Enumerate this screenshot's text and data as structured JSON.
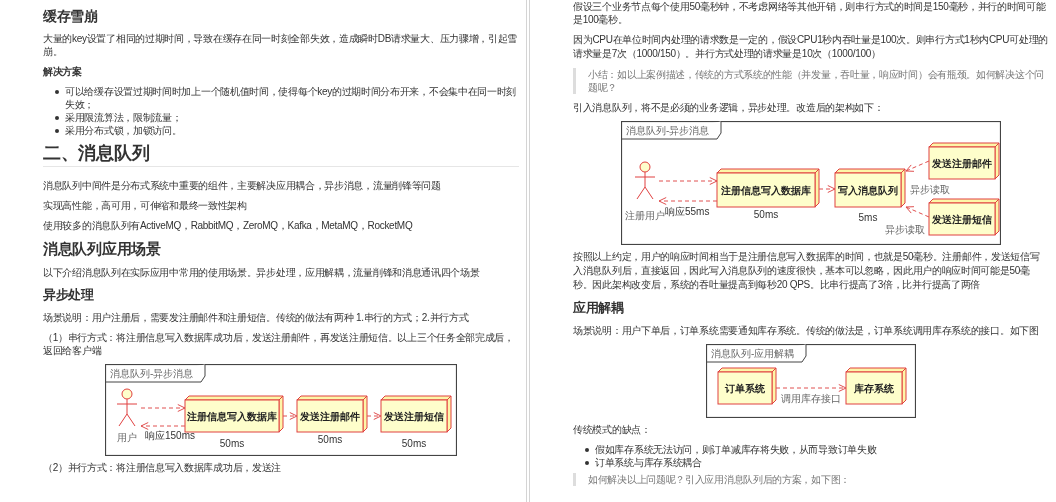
{
  "pages": [
    {
      "blocks": [
        {
          "kind": "h2",
          "text": "缓存雪崩"
        },
        {
          "kind": "p",
          "text": "大量的key设置了相同的过期时间，导致在缓存在同一时刻全部失效，造成瞬时DB请求量大、压力骤增，引起雪崩。"
        },
        {
          "kind": "h5",
          "text": "解决方案"
        },
        {
          "kind": "list",
          "items": [
            "可以给缓存设置过期时间时加上一个随机值时间，使得每个key的过期时间分布开来，不会集中在同一时刻失效；",
            "采用限流算法，限制流量；",
            "采用分布式锁，加锁访问。"
          ]
        },
        {
          "kind": "h1",
          "text": "二、消息队列"
        },
        {
          "kind": "p",
          "text": "消息队列中间件是分布式系统中重要的组件，主要解决应用耦合，异步消息，流量削锋等问题"
        },
        {
          "kind": "p",
          "text": "实现高性能，高可用，可伸缩和最终一致性架构"
        },
        {
          "kind": "p",
          "text": "使用较多的消息队列有ActiveMQ，RabbitMQ，ZeroMQ，Kafka，MetaMQ，RocketMQ"
        },
        {
          "kind": "h3",
          "text": "消息队列应用场景"
        },
        {
          "kind": "p",
          "text": "以下介绍消息队列在实际应用中常用的使用场景。异步处理，应用解耦，流量削锋和消息通讯四个场景"
        },
        {
          "kind": "h4",
          "text": "异步处理"
        },
        {
          "kind": "p",
          "text": "场景说明：用户注册后，需要发注册邮件和注册短信。传统的做法有两种 1.串行的方式；2.并行方式"
        },
        {
          "kind": "p",
          "text": "（1）串行方式：将注册信息写入数据库成功后，发送注册邮件，再发送注册短信。以上三个任务全部完成后，返回给客户端"
        },
        {
          "kind": "diagram",
          "diagram": {
            "kind": "serial",
            "title": "消息队列-异步消息",
            "actor": "用户",
            "nodes": [
              "注册信息写入数据库",
              "发送注册邮件",
              "发送注册短信"
            ],
            "labels": [
              "响应150ms",
              "50ms",
              "50ms",
              "50ms"
            ]
          }
        },
        {
          "kind": "p",
          "text": "（2）并行方式：将注册信息写入数据库成功后，发送注"
        }
      ]
    },
    {
      "blocks": [
        {
          "kind": "p",
          "text": "假设三个业务节点每个使用50毫秒钟，不考虑网络等其他开销，则串行方式的时间是150毫秒，并行的时间可能是100毫秒。"
        },
        {
          "kind": "p",
          "text": "因为CPU在单位时间内处理的请求数是一定的，假设CPU1秒内吞吐量是100次。则串行方式1秒内CPU可处理的请求量是7次（1000/150）。并行方式处理的请求量是10次（1000/100）"
        },
        {
          "kind": "quote",
          "text": "小结：如以上案例描述，传统的方式系统的性能（并发量，吞吐量，响应时间）会有瓶颈。如何解决这个问题呢？"
        },
        {
          "kind": "p",
          "text": "引入消息队列，将不是必须的业务逻辑，异步处理。改造后的架构如下："
        },
        {
          "kind": "diagram",
          "diagram": {
            "kind": "queue",
            "title": "消息队列-异步消息",
            "actor": "注册用户",
            "nodes": [
              "注册信息写入数据库",
              "写入消息队列",
              "发送注册邮件",
              "发送注册短信"
            ],
            "labels": [
              "响应55ms",
              "50ms",
              "5ms",
              "异步读取",
              "异步读取"
            ]
          }
        },
        {
          "kind": "p",
          "text": "按照以上约定，用户的响应时间相当于是注册信息写入数据库的时间，也就是50毫秒。注册邮件，发送短信写入消息队列后，直接返回，因此写入消息队列的速度很快，基本可以忽略，因此用户的响应时间可能是50毫秒。因此架构改变后，系统的吞吐量提高到每秒20 QPS。比串行提高了3倍，比并行提高了两倍"
        },
        {
          "kind": "h4",
          "text": "应用解耦"
        },
        {
          "kind": "p",
          "text": "场景说明：用户下单后，订单系统需要通知库存系统。传统的做法是，订单系统调用库存系统的接口。如下图"
        },
        {
          "kind": "diagram",
          "diagram": {
            "kind": "decouple",
            "title": "消息队列-应用解耦",
            "nodes": [
              "订单系统",
              "库存系统"
            ],
            "labels": [
              "调用库存接口"
            ]
          }
        },
        {
          "kind": "p",
          "text": "传统模式的缺点："
        },
        {
          "kind": "list",
          "items": [
            "假如库存系统无法访问，则订单减库存将失败，从而导致订单失败",
            "订单系统与库存系统耦合"
          ]
        },
        {
          "kind": "quote",
          "text": "如何解决以上问题呢？引入应用消息队列后的方案，如下图："
        }
      ]
    }
  ]
}
